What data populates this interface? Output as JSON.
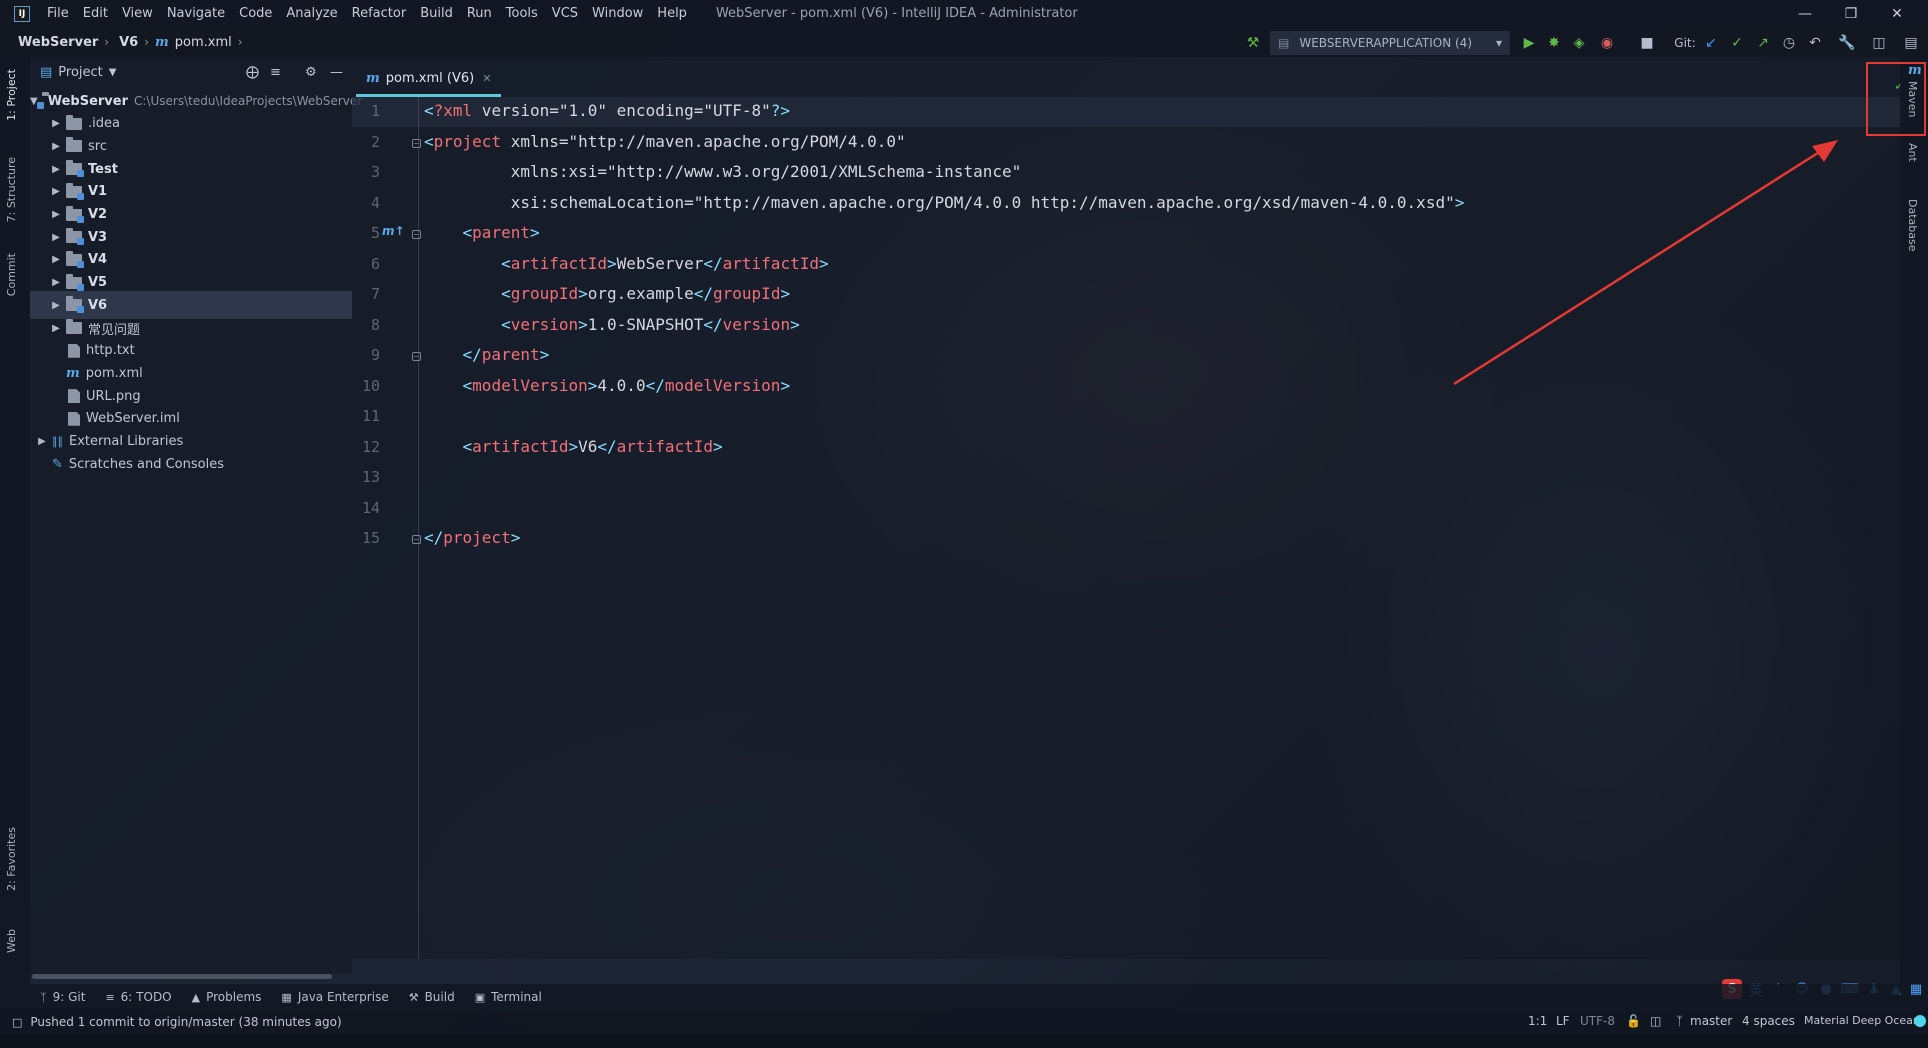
{
  "app": {
    "menu": [
      "File",
      "Edit",
      "View",
      "Navigate",
      "Code",
      "Analyze",
      "Refactor",
      "Build",
      "Run",
      "Tools",
      "VCS",
      "Window",
      "Help"
    ],
    "window_title": "WebServer - pom.xml (V6) - IntelliJ IDEA - Administrator",
    "logo_text": "IJ"
  },
  "breadcrumb": {
    "project": "WebServer",
    "module": "V6",
    "file": "pom.xml"
  },
  "toolbar": {
    "run_config": "WEBSERVERAPPLICATION (4)",
    "git_label": "Git:"
  },
  "left_tabs": [
    "1: Project",
    "7: Structure",
    "Commit",
    "2: Favorites",
    "Web"
  ],
  "right_tabs": [
    "Maven",
    "Ant",
    "Database"
  ],
  "project_panel": {
    "title": "Project",
    "tree": [
      {
        "label": "WebServer",
        "hint": "C:\\Users\\tedu\\IdeaProjects\\WebServer",
        "kind": "module",
        "bold": true,
        "expanded": true
      },
      {
        "label": ".idea",
        "kind": "folder"
      },
      {
        "label": "src",
        "kind": "folder"
      },
      {
        "label": "Test",
        "kind": "module",
        "bold": true
      },
      {
        "label": "V1",
        "kind": "module",
        "bold": true
      },
      {
        "label": "V2",
        "kind": "module",
        "bold": true
      },
      {
        "label": "V3",
        "kind": "module",
        "bold": true
      },
      {
        "label": "V4",
        "kind": "module",
        "bold": true
      },
      {
        "label": "V5",
        "kind": "module",
        "bold": true
      },
      {
        "label": "V6",
        "kind": "module",
        "bold": true,
        "selected": true
      },
      {
        "label": "常见问题",
        "kind": "folder"
      },
      {
        "label": "http.txt",
        "kind": "file"
      },
      {
        "label": "pom.xml",
        "kind": "maven"
      },
      {
        "label": "URL.png",
        "kind": "file"
      },
      {
        "label": "WebServer.iml",
        "kind": "file"
      },
      {
        "label": "External Libraries",
        "kind": "libs"
      },
      {
        "label": "Scratches and Consoles",
        "kind": "scratch"
      }
    ]
  },
  "editor": {
    "tab_label": "pom.xml (V6)",
    "lines": [
      "<?xml version=\"1.0\" encoding=\"UTF-8\"?>",
      "<project xmlns=\"http://maven.apache.org/POM/4.0.0\"",
      "         xmlns:xsi=\"http://www.w3.org/2001/XMLSchema-instance\"",
      "         xsi:schemaLocation=\"http://maven.apache.org/POM/4.0.0 http://maven.apache.org/xsd/maven-4.0.0.xsd\">",
      "    <parent>",
      "        <artifactId>WebServer</artifactId>",
      "        <groupId>org.example</groupId>",
      "        <version>1.0-SNAPSHOT</version>",
      "    </parent>",
      "    <modelVersion>4.0.0</modelVersion>",
      "",
      "    <artifactId>V6</artifactId>",
      "",
      "",
      "</project>"
    ]
  },
  "bottom_tabs": [
    "9: Git",
    "6: TODO",
    "Problems",
    "Java Enterprise",
    "Build",
    "Terminal"
  ],
  "status": {
    "message": "Pushed 1 commit to origin/master (38 minutes ago)",
    "position": "1:1",
    "line_sep": "LF",
    "encoding": "UTF-8",
    "branch": "master",
    "indent": "4 spaces",
    "theme": "Material Deep Ocean"
  },
  "colors": {
    "accent": "#5fc7d8",
    "tag": "#f07178",
    "attr": "#ffcb6b",
    "string": "#c3e88d",
    "highlight": "#e53935"
  }
}
